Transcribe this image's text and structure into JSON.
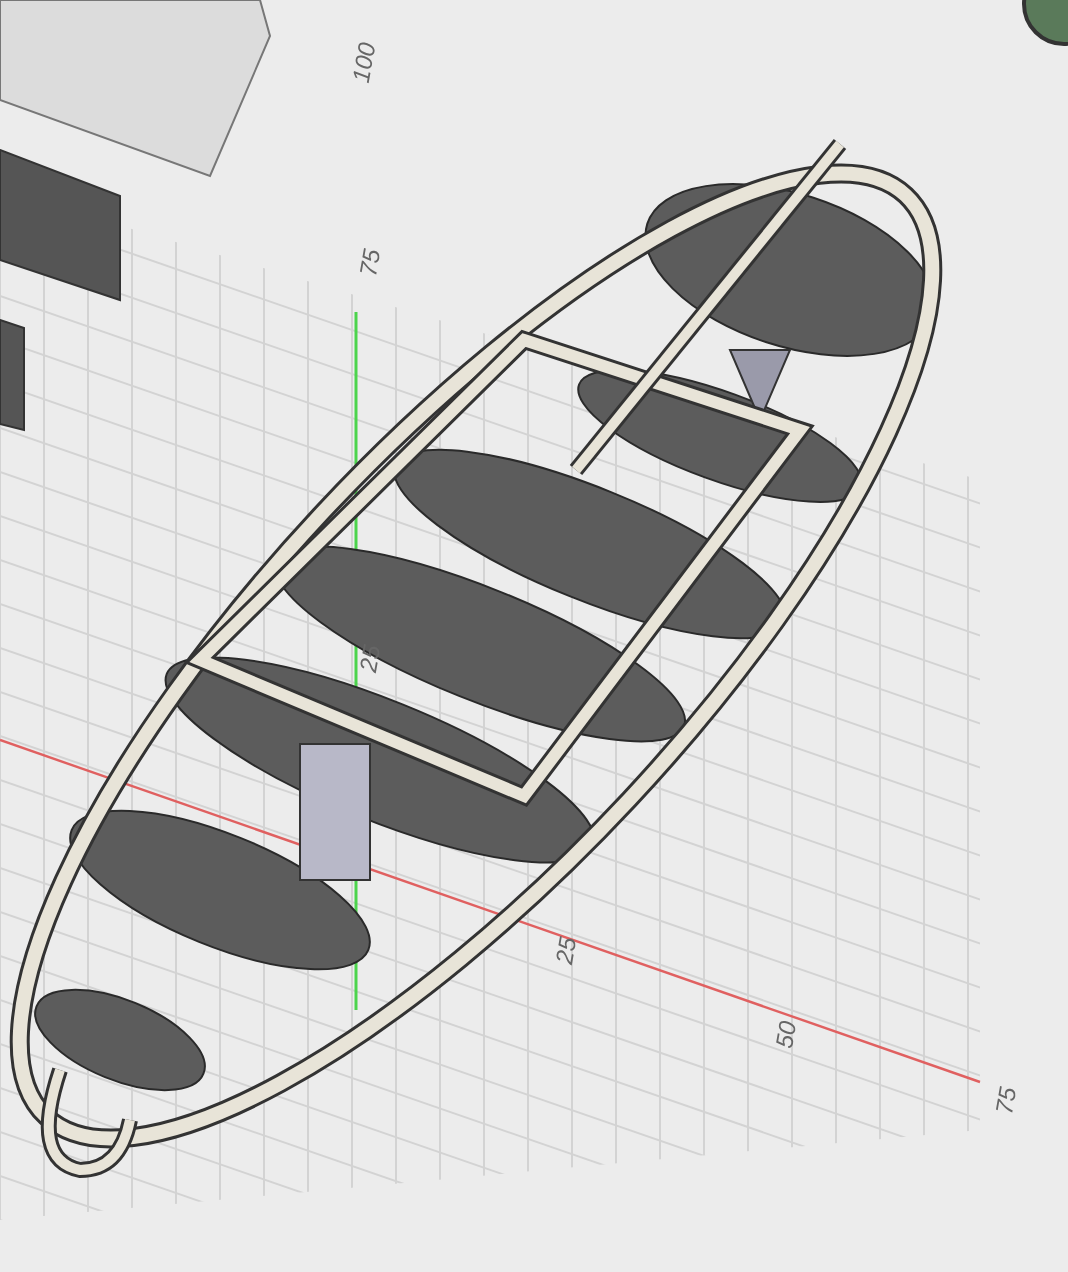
{
  "viewport": {
    "vertical_axis_labels": [
      "100",
      "75",
      "25"
    ],
    "horizontal_axis_labels": [
      "25",
      "50",
      "75"
    ]
  }
}
